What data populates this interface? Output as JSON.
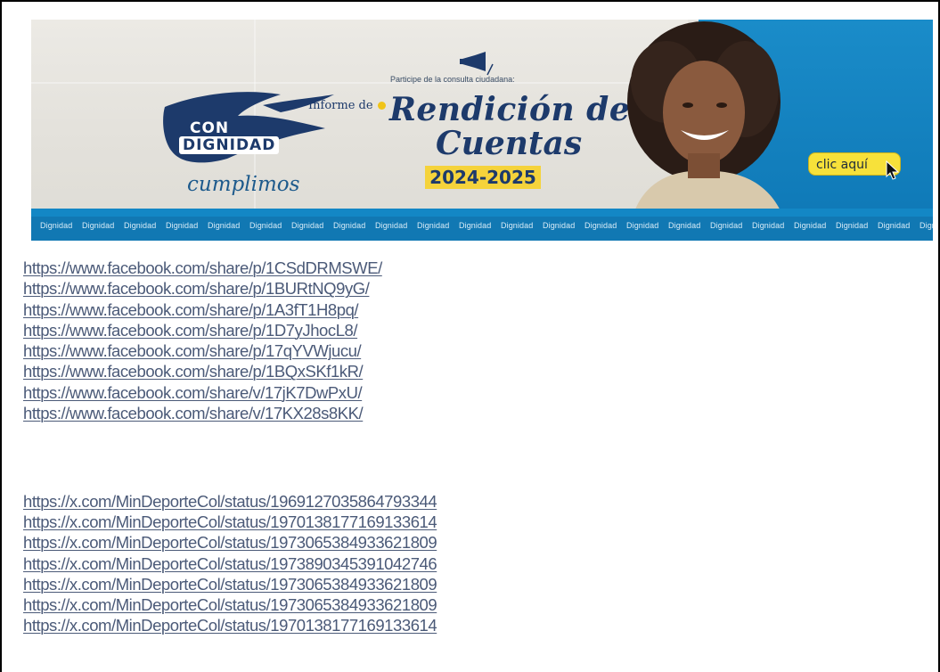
{
  "banner": {
    "brand_line1": "CON",
    "brand_line2": "DIGNIDAD",
    "brand_tagline": "cumplimos",
    "participa": "Participe de la consulta ciudadana:",
    "informe_de": "Informe de",
    "headline_1": "Rendición de",
    "headline_2": "Cuentas",
    "years": "2024-2025",
    "cta_label": "clic aquí",
    "ribbon_word": "Dignidad",
    "colors": {
      "navy": "#1d3a6b",
      "blue": "#1387c5",
      "yellow": "#f5d33b"
    }
  },
  "facebook_links": [
    "https://www.facebook.com/share/p/1CSdDRMSWE/",
    "https://www.facebook.com/share/p/1BURtNQ9yG/",
    "https://www.facebook.com/share/p/1A3fT1H8pq/",
    "https://www.facebook.com/share/p/1D7yJhocL8/",
    "https://www.facebook.com/share/p/17qYVWjucu/",
    "https://www.facebook.com/share/p/1BQxSKf1kR/",
    "https://www.facebook.com/share/v/17jK7DwPxU/",
    "https://www.facebook.com/share/v/17KX28s8KK/"
  ],
  "x_links": [
    "https://x.com/MinDeporteCol/status/1969127035864793344",
    "https://x.com/MinDeporteCol/status/1970138177169133614",
    "https://x.com/MinDeporteCol/status/1973065384933621809",
    "https://x.com/MinDeporteCol/status/1973890345391042746",
    "https://x.com/MinDeporteCol/status/1973065384933621809",
    "https://x.com/MinDeporteCol/status/1973065384933621809",
    "https://x.com/MinDeporteCol/status/1970138177169133614"
  ]
}
